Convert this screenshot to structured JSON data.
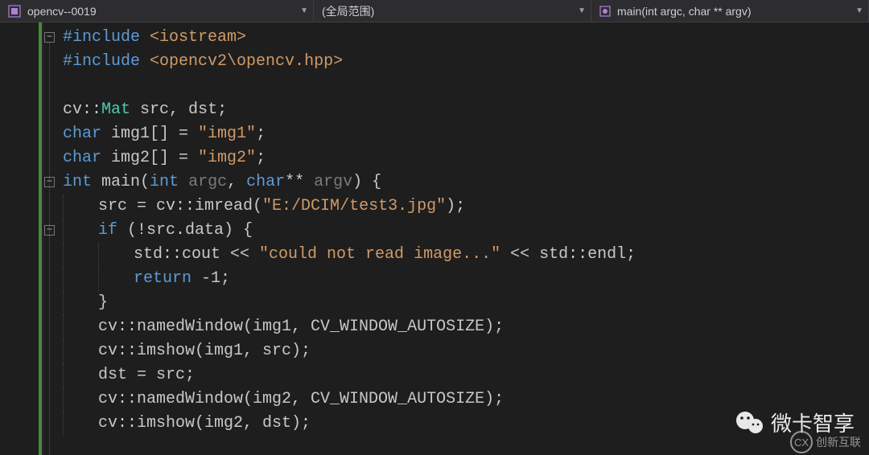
{
  "topbar": {
    "project": "opencv--0019",
    "scope": "(全局范围)",
    "function": "main(int argc, char ** argv)"
  },
  "code": {
    "lines": [
      {
        "indent": 0,
        "outline": "minus",
        "tokens": [
          {
            "t": "#include ",
            "c": "kw"
          },
          {
            "t": "<iostream>",
            "c": "str"
          }
        ]
      },
      {
        "indent": 0,
        "tokens": [
          {
            "t": "#include ",
            "c": "kw"
          },
          {
            "t": "<opencv2\\opencv.hpp>",
            "c": "str"
          }
        ]
      },
      {
        "indent": 0,
        "tokens": []
      },
      {
        "indent": 0,
        "tokens": [
          {
            "t": "cv",
            "c": "punct"
          },
          {
            "t": "::",
            "c": "punct"
          },
          {
            "t": "Mat",
            "c": "type"
          },
          {
            "t": " src, dst;",
            "c": "punct"
          }
        ]
      },
      {
        "indent": 0,
        "tokens": [
          {
            "t": "char",
            "c": "kw"
          },
          {
            "t": " img1[] = ",
            "c": "punct"
          },
          {
            "t": "\"img1\"",
            "c": "str"
          },
          {
            "t": ";",
            "c": "punct"
          }
        ]
      },
      {
        "indent": 0,
        "tokens": [
          {
            "t": "char",
            "c": "kw"
          },
          {
            "t": " img2[] = ",
            "c": "punct"
          },
          {
            "t": "\"img2\"",
            "c": "str"
          },
          {
            "t": ";",
            "c": "punct"
          }
        ]
      },
      {
        "indent": 0,
        "outline": "minus",
        "tokens": [
          {
            "t": "int",
            "c": "kw"
          },
          {
            "t": " main(",
            "c": "punct"
          },
          {
            "t": "int",
            "c": "kw"
          },
          {
            "t": " ",
            "c": "punct"
          },
          {
            "t": "argc",
            "c": "param"
          },
          {
            "t": ", ",
            "c": "punct"
          },
          {
            "t": "char",
            "c": "kw"
          },
          {
            "t": "** ",
            "c": "punct"
          },
          {
            "t": "argv",
            "c": "param"
          },
          {
            "t": ") {",
            "c": "punct"
          }
        ]
      },
      {
        "indent": 1,
        "tokens": [
          {
            "t": "src = cv::imread(",
            "c": "punct"
          },
          {
            "t": "\"E:/DCIM/test3.jpg\"",
            "c": "str"
          },
          {
            "t": ");",
            "c": "punct"
          }
        ]
      },
      {
        "indent": 1,
        "outline": "minus",
        "tokens": [
          {
            "t": "if",
            "c": "kw"
          },
          {
            "t": " (!src.data) {",
            "c": "punct"
          }
        ]
      },
      {
        "indent": 2,
        "tokens": [
          {
            "t": "std::cout << ",
            "c": "punct"
          },
          {
            "t": "\"could not read image...\"",
            "c": "str"
          },
          {
            "t": " << std::endl;",
            "c": "punct"
          }
        ]
      },
      {
        "indent": 2,
        "tokens": [
          {
            "t": "return",
            "c": "kw"
          },
          {
            "t": " -1;",
            "c": "punct"
          }
        ]
      },
      {
        "indent": 1,
        "tokens": [
          {
            "t": "}",
            "c": "punct"
          }
        ]
      },
      {
        "indent": 1,
        "tokens": [
          {
            "t": "cv::namedWindow(img1, CV_WINDOW_AUTOSIZE);",
            "c": "punct"
          }
        ]
      },
      {
        "indent": 1,
        "tokens": [
          {
            "t": "cv::imshow(img1, src);",
            "c": "punct"
          }
        ]
      },
      {
        "indent": 1,
        "tokens": [
          {
            "t": "dst = src;",
            "c": "punct"
          }
        ]
      },
      {
        "indent": 1,
        "tokens": [
          {
            "t": "cv::namedWindow(img2, CV_WINDOW_AUTOSIZE);",
            "c": "punct"
          }
        ]
      },
      {
        "indent": 1,
        "tokens": [
          {
            "t": "cv::imshow(img2, dst);",
            "c": "punct"
          }
        ]
      }
    ]
  },
  "watermarks": {
    "main": "微卡智享",
    "second": "创新互联"
  }
}
